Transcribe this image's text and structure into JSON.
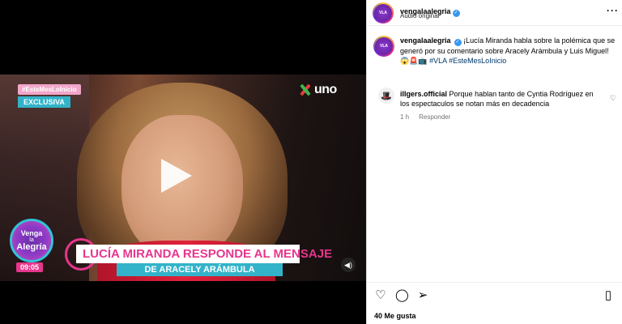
{
  "video": {
    "hashtag_tag": "#EsteMesLoInicio",
    "exclusive_tag": "EXCLUSIVA",
    "channel_name": "uno",
    "show_logo": {
      "line1": "Venga",
      "line2": "la",
      "line3": "Alegría"
    },
    "time": "09:05",
    "headline": "LUCÍA MIRANDA RESPONDE AL MENSAJE",
    "subheadline": "DE ARACELY ARÁMBULA",
    "play_icon": "play-icon",
    "mute_icon": "volume-icon"
  },
  "post": {
    "header": {
      "username": "vengalaalegria",
      "audio": "Audio original",
      "more_icon": "more-horizontal-icon"
    },
    "caption": {
      "username": "vengalaalegria",
      "text": "¡Lucía Miranda habla sobre la polémica que se generó por su comentario sobre Aracely Arámbula y Luis Miguel! 😱🚨📺",
      "hashtags": "#VLA #EsteMesLoInicio"
    },
    "comments": [
      {
        "username": "illgers.official",
        "text": "Porque hablan tanto de Cyntia Rodríguez en los espectaculos se notan más en decadencia",
        "time": "1 h",
        "reply_label": "Responder"
      }
    ],
    "likes": "40 Me gusta",
    "colors": {
      "verified": "#3897f0",
      "accent_pink": "#e7368d",
      "accent_cyan": "#33b3c9"
    }
  }
}
